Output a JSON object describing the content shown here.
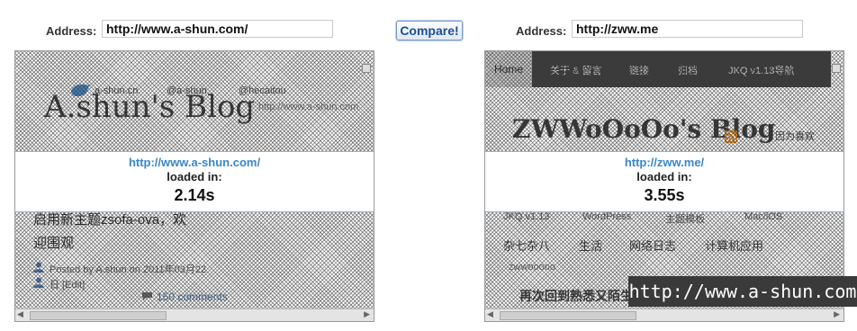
{
  "left": {
    "address_label": "Address:",
    "address_value": "http://www.a-shun.com/",
    "site": {
      "social_1": "a-shun.cn",
      "social_2": "@a-shun",
      "social_3": "@hecaitou",
      "logo": "A.shun's Blog",
      "tagline": "http://www.a-shun.com",
      "body_line_1": "启用新主题zsofa-ova，欢",
      "body_line_2": "迎围观",
      "meta_author": "Posted by A.shun on 2011年03月22",
      "meta_edit": "日 [Edit]",
      "comments": "150 comments"
    },
    "overlay": {
      "url": "http://www.a-shun.com/",
      "loaded_label": "loaded in:",
      "time": "2.14s"
    }
  },
  "compare_label": "Compare!",
  "right": {
    "address_label": "Address:",
    "address_value": "http://zww.me",
    "site": {
      "nav": [
        "Home",
        "关于 & 留言",
        "链接",
        "归档",
        "JKQ v1.13导航"
      ],
      "logo": "ZWWoOoOo's Blog",
      "tagline": "因为喜欢",
      "row1": [
        "JKQ v1.13",
        "WordPress",
        "主题模板",
        "Mac/iOS"
      ],
      "row2": [
        "杂七杂八",
        "生活",
        "网络日志",
        "计算机应用"
      ],
      "sub": "zwwooooo",
      "post_title": "再次回到熟悉又陌生"
    },
    "overlay": {
      "url": "http://zww.me/",
      "loaded_label": "loaded in:",
      "time": "3.55s"
    }
  },
  "watermark": "http://www.a-shun.com"
}
